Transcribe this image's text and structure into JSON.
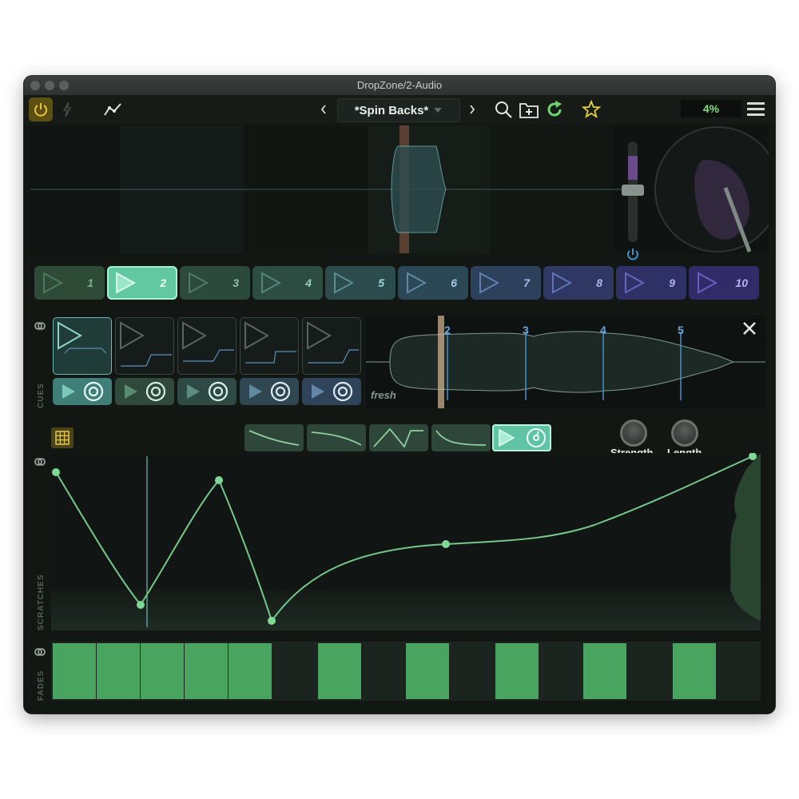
{
  "window": {
    "title": "DropZone/2-Audio"
  },
  "toolbar": {
    "preset_name": "*Spin Backs*",
    "cpu": "4%",
    "icons": [
      "power-icon",
      "bolt-icon",
      "graph-icon",
      "prev-chevron-icon",
      "next-chevron-icon",
      "search-icon",
      "add-folder-icon",
      "refresh-icon",
      "star-icon",
      "menu-icon"
    ]
  },
  "pads": [
    {
      "label": "1",
      "color": "#3f6b4e"
    },
    {
      "label": "2",
      "color": "#62c8a2"
    },
    {
      "label": "3",
      "color": "#3d6652"
    },
    {
      "label": "4",
      "color": "#3e6b5b"
    },
    {
      "label": "5",
      "color": "#3e6b68"
    },
    {
      "label": "6",
      "color": "#3e6572"
    },
    {
      "label": "7",
      "color": "#3f5b7b"
    },
    {
      "label": "8",
      "color": "#404f80"
    },
    {
      "label": "9",
      "color": "#414683"
    },
    {
      "label": "10",
      "color": "#433f84"
    }
  ],
  "cues": {
    "section_label": "CUES",
    "preset_label": "fresh",
    "markers": [
      "2",
      "3",
      "4",
      "5"
    ]
  },
  "scratches": {
    "section_label": "SCRATCHES",
    "strength_label": "Strength",
    "length_label": "Length"
  },
  "fades": {
    "section_label": "FADES"
  },
  "colors": {
    "accent": "#6fd38a",
    "fade": "#49a45f",
    "background": "#121714"
  }
}
